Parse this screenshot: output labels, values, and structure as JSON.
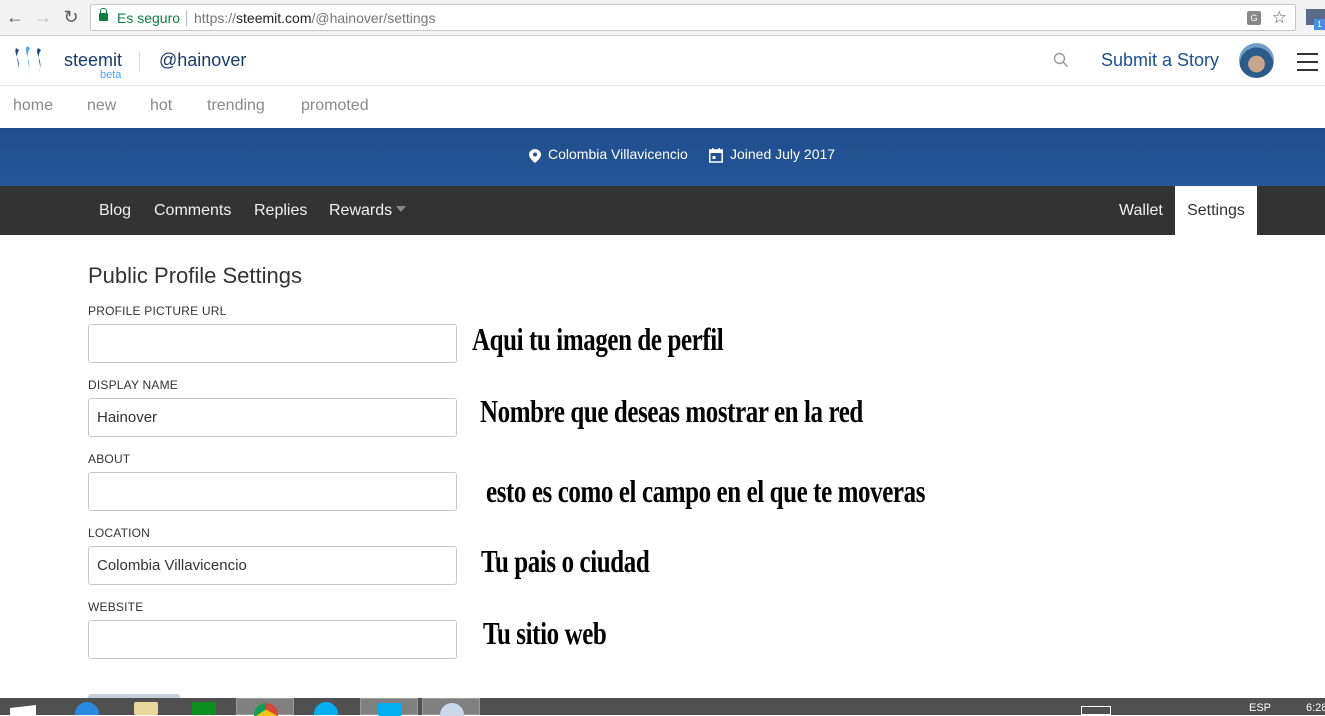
{
  "browser": {
    "secure_label": "Es seguro",
    "url_scheme": "https://",
    "url_host": "steemit.com",
    "url_path": "/@hainover/settings",
    "extension_badge": "1"
  },
  "header": {
    "brand": "steemit",
    "beta": "beta",
    "username": "@hainover",
    "submit_story": "Submit a Story"
  },
  "sub_nav": [
    {
      "label": "home"
    },
    {
      "label": "new"
    },
    {
      "label": "hot"
    },
    {
      "label": "trending"
    },
    {
      "label": "promoted"
    }
  ],
  "banner": {
    "location": "Colombia Villavicencio",
    "joined": "Joined July 2017"
  },
  "tabs": {
    "left": [
      {
        "label": "Blog"
      },
      {
        "label": "Comments"
      },
      {
        "label": "Replies"
      },
      {
        "label": "Rewards"
      }
    ],
    "right": [
      {
        "label": "Wallet"
      },
      {
        "label": "Settings",
        "active": true
      }
    ]
  },
  "settings": {
    "title": "Public Profile Settings",
    "fields": [
      {
        "label": "PROFILE PICTURE URL",
        "value": ""
      },
      {
        "label": "DISPLAY NAME",
        "value": "Hainover"
      },
      {
        "label": "ABOUT",
        "value": ""
      },
      {
        "label": "LOCATION",
        "value": "Colombia Villavicencio"
      },
      {
        "label": "WEBSITE",
        "value": ""
      }
    ]
  },
  "annotations": [
    "Aqui tu imagen de perfil",
    "Nombre que deseas mostrar en la red",
    "esto es como el campo en el que te moveras",
    "Tu pais o ciudad",
    "Tu sitio web"
  ],
  "taskbar": {
    "language": "ESP",
    "time": "6:28"
  },
  "colors": {
    "brand_blue": "#1a5099",
    "banner_blue": "#1f4e8c",
    "tab_bar": "#333333",
    "secure_green": "#0b8043"
  }
}
